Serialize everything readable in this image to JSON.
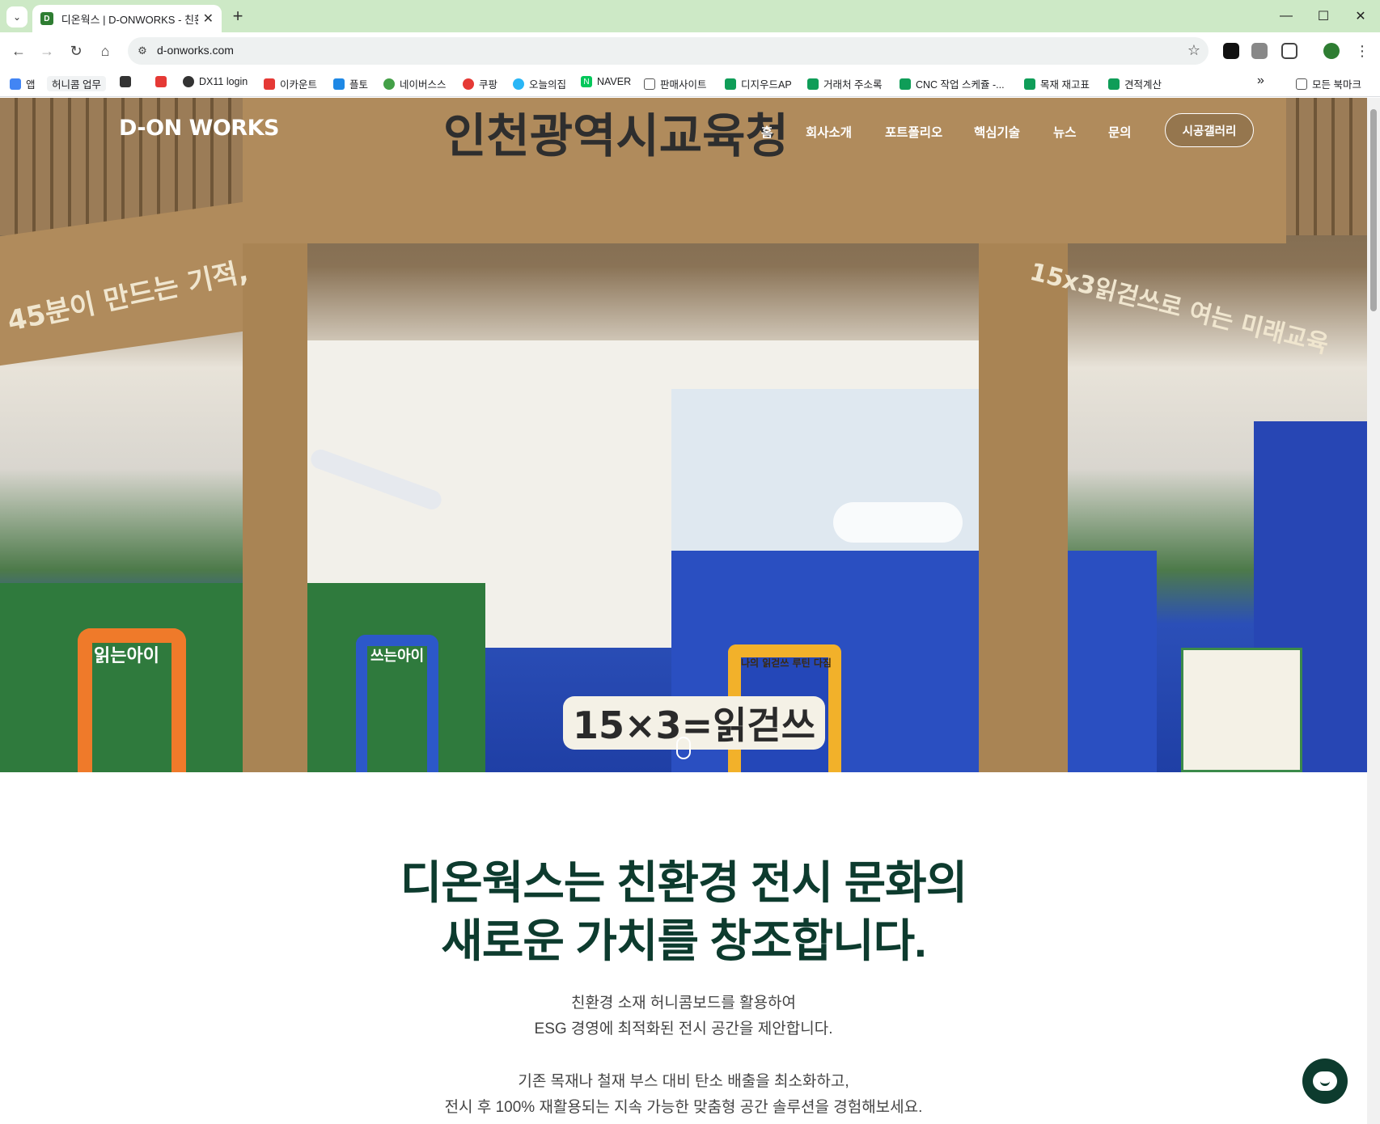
{
  "browser": {
    "tab_title": "디온웍스 | D-ONWORKS - 친환",
    "tab_favicon_letter": "D",
    "url": "d-onworks.com",
    "new_tab": "+",
    "tab_close": "✕",
    "minimize": "—",
    "maximize": "☐",
    "close": "✕"
  },
  "bookmarks": [
    {
      "label": "앱",
      "icon": "apps-grid-icon",
      "color": "#4285f4"
    },
    {
      "label": "허니콤 업무",
      "icon": "",
      "color": ""
    },
    {
      "label": "",
      "icon": "grid-icon",
      "color": "#333333"
    },
    {
      "label": "",
      "icon": "pinwheel-icon",
      "color": "#e53935"
    },
    {
      "label": "DX11 login",
      "icon": "globe-icon",
      "color": "#333333"
    },
    {
      "label": "이카운트",
      "icon": "ecount-icon",
      "color": "#e53935"
    },
    {
      "label": "플토",
      "icon": "plto-icon",
      "color": "#1e88e5"
    },
    {
      "label": "네이버스스",
      "icon": "smartstore-icon",
      "color": "#43a047"
    },
    {
      "label": "쿠팡",
      "icon": "coupang-icon",
      "color": "#e53935"
    },
    {
      "label": "오늘의집",
      "icon": "ohouse-icon",
      "color": "#29b6f6"
    },
    {
      "label": "NAVER",
      "icon": "naver-icon",
      "color": "#03c75a"
    },
    {
      "label": "판매사이트",
      "icon": "folder-icon",
      "color": "#555555"
    },
    {
      "label": "디지우드AP",
      "icon": "sheets-icon",
      "color": "#0f9d58"
    },
    {
      "label": "거래처 주소록",
      "icon": "sheets-icon",
      "color": "#0f9d58"
    },
    {
      "label": "CNC 작업 스케쥴 -...",
      "icon": "sheets-icon",
      "color": "#0f9d58"
    },
    {
      "label": "목재 재고표",
      "icon": "sheets-icon",
      "color": "#0f9d58"
    },
    {
      "label": "견적계산",
      "icon": "sheets-icon",
      "color": "#0f9d58"
    }
  ],
  "bookmarks_more": "»",
  "all_bookmarks": "모든 북마크",
  "site": {
    "logo": "D-ON WORKS",
    "nav": [
      "홈",
      "회사소개",
      "포트폴리오",
      "핵심기술",
      "뉴스",
      "문의"
    ],
    "gallery_button": "시공갤러리"
  },
  "hero_signage": {
    "top_banner": "인천광역시교육청",
    "left_banner": "45분이 만드는 기적,",
    "right_banner": "15x3읽걷쓰로 여는 미래교육",
    "orange_frame": "읽는아이",
    "blue_frame": "쓰는아이",
    "yellow_frame": "나의 읽걷쓰 루틴 다짐",
    "center_sign": "15×3=읽걷쓰"
  },
  "content": {
    "headline_line1": "디온웍스는 친환경 전시 문화의",
    "headline_line2": "새로운 가치를 창조합니다.",
    "para1_line1": "친환경 소재 허니콤보드를 활용하여",
    "para1_line2": "ESG 경영에 최적화된 전시 공간을 제안합니다.",
    "para2_line1": "기존 목재나 철재 부스 대비 탄소 배출을 최소화하고,",
    "para2_line2": "전시 후 100% 재활용되는 지속 가능한 맞춤형 공간 솔루션을 경험해보세요."
  },
  "colors": {
    "tab_strip": "#cde9c6",
    "brand_dark_green": "#0d3b2e"
  }
}
